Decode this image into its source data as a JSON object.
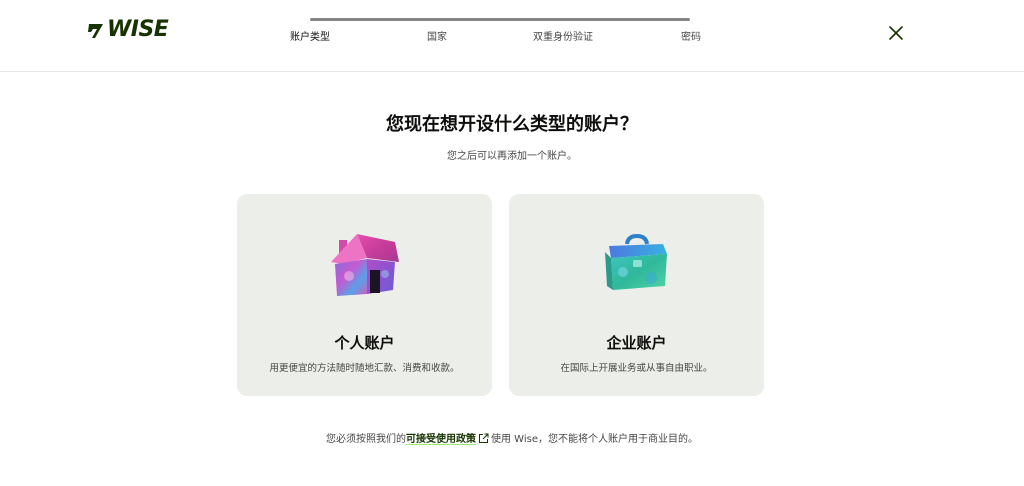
{
  "header": {
    "logo_text": "WISE",
    "brand_color": "#163300",
    "close_icon": "close-icon"
  },
  "stepper": {
    "steps": [
      {
        "label": "账户类型",
        "active": true
      },
      {
        "label": "国家",
        "active": false
      },
      {
        "label": "双重身份验证",
        "active": false
      },
      {
        "label": "密码",
        "active": false
      }
    ]
  },
  "main": {
    "title": "您现在想开设什么类型的账户？",
    "subtitle": "您之后可以再添加一个账户。",
    "cards": [
      {
        "title": "个人账户",
        "description": "用更便宜的方法随时随地汇款、消费和收款。",
        "icon": "house-icon"
      },
      {
        "title": "企业账户",
        "description": "在国际上开展业务或从事自由职业。",
        "icon": "briefcase-icon"
      }
    ]
  },
  "footer": {
    "text_before": "您必须按照我们的",
    "policy_link": "可接受使用政策",
    "text_after": "使用 Wise，您不能将个人账户用于商业目的。",
    "link_icon": "external-link-icon"
  }
}
